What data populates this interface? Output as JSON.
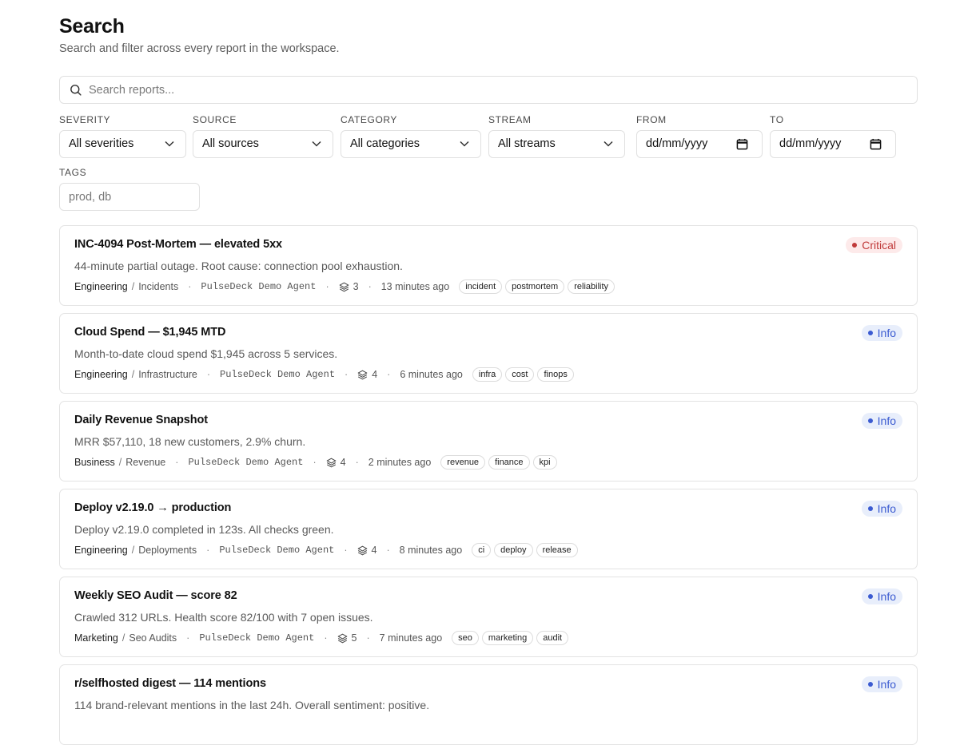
{
  "header": {
    "title": "Search",
    "subtitle": "Search and filter across every report in the workspace."
  },
  "search": {
    "placeholder": "Search reports..."
  },
  "filters": {
    "severity": {
      "label": "SEVERITY",
      "value": "All severities"
    },
    "source": {
      "label": "SOURCE",
      "value": "All sources"
    },
    "category": {
      "label": "CATEGORY",
      "value": "All categories"
    },
    "stream": {
      "label": "STREAM",
      "value": "All streams"
    },
    "from": {
      "label": "FROM",
      "value": "dd/mm/yyyy"
    },
    "to": {
      "label": "TO",
      "value": "dd/mm/yyyy"
    },
    "tags": {
      "label": "TAGS",
      "placeholder": "prod, db"
    }
  },
  "reports": [
    {
      "title": "INC-4094 Post-Mortem — elevated 5xx",
      "description": "44-minute partial outage. Root cause: connection pool exhaustion.",
      "stream": "Engineering",
      "category": "Incidents",
      "agent": "PulseDeck Demo Agent",
      "count": "3",
      "time": "13 minutes ago",
      "tags": [
        "incident",
        "postmortem",
        "reliability"
      ],
      "severity": "Critical",
      "severity_color": "#c03a3a"
    },
    {
      "title": "Cloud Spend — $1,945 MTD",
      "description": "Month-to-date cloud spend $1,945 across 5 services.",
      "stream": "Engineering",
      "category": "Infrastructure",
      "agent": "PulseDeck Demo Agent",
      "count": "4",
      "time": "6 minutes ago",
      "tags": [
        "infra",
        "cost",
        "finops"
      ],
      "severity": "Info",
      "severity_color": "#3b5bd1"
    },
    {
      "title": "Daily Revenue Snapshot",
      "description": "MRR $57,110, 18 new customers, 2.9% churn.",
      "stream": "Business",
      "category": "Revenue",
      "agent": "PulseDeck Demo Agent",
      "count": "4",
      "time": "2 minutes ago",
      "tags": [
        "revenue",
        "finance",
        "kpi"
      ],
      "severity": "Info",
      "severity_color": "#3b5bd1"
    },
    {
      "title": "Deploy v2.19.0 → production",
      "description": "Deploy v2.19.0 completed in 123s. All checks green.",
      "stream": "Engineering",
      "category": "Deployments",
      "agent": "PulseDeck Demo Agent",
      "count": "4",
      "time": "8 minutes ago",
      "tags": [
        "ci",
        "deploy",
        "release"
      ],
      "severity": "Info",
      "severity_color": "#3b5bd1"
    },
    {
      "title": "Weekly SEO Audit — score 82",
      "description": "Crawled 312 URLs. Health score 82/100 with 7 open issues.",
      "stream": "Marketing",
      "category": "Seo Audits",
      "agent": "PulseDeck Demo Agent",
      "count": "5",
      "time": "7 minutes ago",
      "tags": [
        "seo",
        "marketing",
        "audit"
      ],
      "severity": "Info",
      "severity_color": "#3b5bd1"
    },
    {
      "title": "r/selfhosted digest — 114 mentions",
      "description": "114 brand-relevant mentions in the last 24h. Overall sentiment: positive.",
      "stream": "",
      "category": "",
      "agent": "",
      "count": "",
      "time": "",
      "tags": [],
      "severity": "Info",
      "severity_color": "#3b5bd1"
    }
  ]
}
